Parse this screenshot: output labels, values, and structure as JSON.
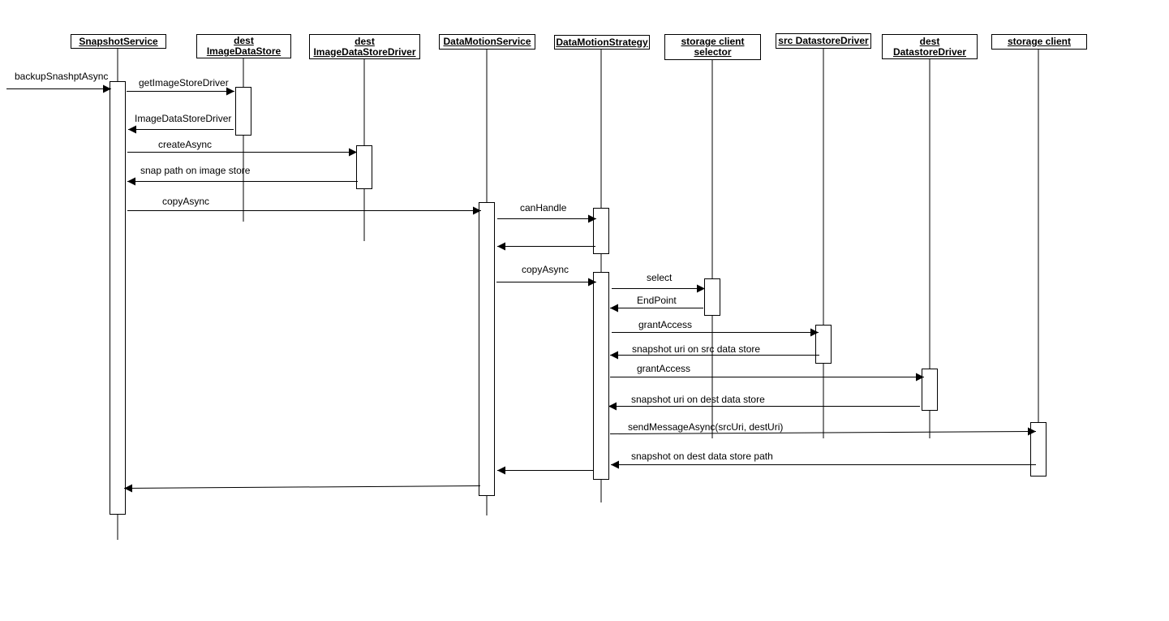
{
  "diagram": {
    "type": "sequence",
    "participants": [
      {
        "id": "snapshot_service",
        "label": "SnapshotService"
      },
      {
        "id": "dest_image_data_store",
        "label": "dest \nImageDataStore"
      },
      {
        "id": "dest_image_data_store_driver",
        "label": "dest \nImageDataStoreDriver"
      },
      {
        "id": "data_motion_service",
        "label": "DataMotionService"
      },
      {
        "id": "data_motion_strategy",
        "label": "DataMotionStrategy"
      },
      {
        "id": "storage_client_selector",
        "label": "storage client \nselector"
      },
      {
        "id": "src_datastore_driver",
        "label": "src DatastoreDriver"
      },
      {
        "id": "dest_datastore_driver",
        "label": "dest \nDatastoreDriver"
      },
      {
        "id": "storage_client",
        "label": "storage client"
      }
    ],
    "messages": [
      {
        "from": "external",
        "to": "snapshot_service",
        "label": "backupSnashptAsync",
        "kind": "call"
      },
      {
        "from": "snapshot_service",
        "to": "dest_image_data_store",
        "label": "getImageStoreDriver",
        "kind": "call"
      },
      {
        "from": "dest_image_data_store",
        "to": "snapshot_service",
        "label": "ImageDataStoreDriver",
        "kind": "return"
      },
      {
        "from": "snapshot_service",
        "to": "dest_image_data_store_driver",
        "label": "createAsync",
        "kind": "call"
      },
      {
        "from": "dest_image_data_store_driver",
        "to": "snapshot_service",
        "label": "snap path on image store",
        "kind": "return"
      },
      {
        "from": "snapshot_service",
        "to": "data_motion_service",
        "label": "copyAsync",
        "kind": "call"
      },
      {
        "from": "data_motion_service",
        "to": "data_motion_strategy",
        "label": "canHandle",
        "kind": "call"
      },
      {
        "from": "data_motion_strategy",
        "to": "data_motion_service",
        "label": "",
        "kind": "return"
      },
      {
        "from": "data_motion_service",
        "to": "data_motion_strategy",
        "label": "copyAsync",
        "kind": "call"
      },
      {
        "from": "data_motion_strategy",
        "to": "storage_client_selector",
        "label": "select",
        "kind": "call"
      },
      {
        "from": "storage_client_selector",
        "to": "data_motion_strategy",
        "label": "EndPoint",
        "kind": "return"
      },
      {
        "from": "data_motion_strategy",
        "to": "src_datastore_driver",
        "label": "grantAccess",
        "kind": "call"
      },
      {
        "from": "src_datastore_driver",
        "to": "data_motion_strategy",
        "label": "snapshot uri on src data store",
        "kind": "return"
      },
      {
        "from": "data_motion_strategy",
        "to": "dest_datastore_driver",
        "label": "grantAccess",
        "kind": "call"
      },
      {
        "from": "dest_datastore_driver",
        "to": "data_motion_strategy",
        "label": "snapshot uri on dest data store",
        "kind": "return"
      },
      {
        "from": "data_motion_strategy",
        "to": "storage_client",
        "label": "sendMessageAsync(srcUri, destUri)",
        "kind": "call"
      },
      {
        "from": "storage_client",
        "to": "data_motion_strategy",
        "label": "snapshot on dest data store path",
        "kind": "return"
      },
      {
        "from": "data_motion_strategy",
        "to": "data_motion_service",
        "label": "",
        "kind": "return"
      },
      {
        "from": "data_motion_service",
        "to": "snapshot_service",
        "label": "",
        "kind": "return"
      }
    ]
  }
}
